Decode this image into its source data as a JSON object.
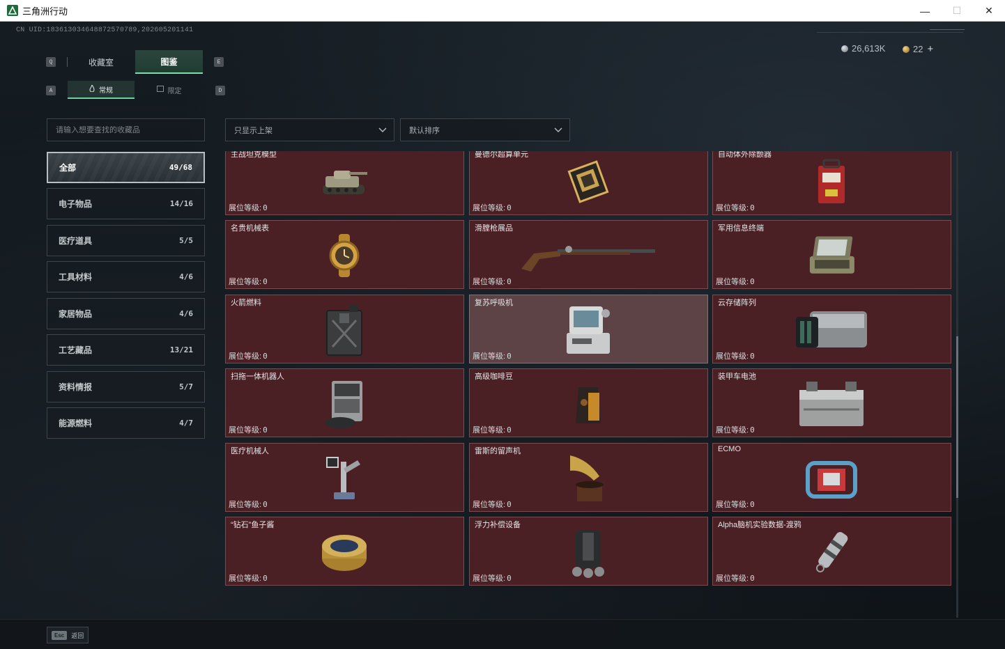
{
  "window": {
    "title": "三角洲行动",
    "minimize": "—",
    "maximize": "☐",
    "close": "✕"
  },
  "uid": "CN UID:18361303464887257078​9,202605201141",
  "currency": {
    "silver": "26,613K",
    "gold": "22",
    "plus": "+"
  },
  "keyhints": {
    "q": "Q",
    "e": "E",
    "a": "A",
    "d": "D"
  },
  "tabs": [
    {
      "label": "收藏室",
      "active": false
    },
    {
      "label": "图鉴",
      "active": true
    }
  ],
  "subtabs": [
    {
      "label": "常规",
      "icon": "flame-icon",
      "active": true
    },
    {
      "label": "限定",
      "icon": "box-icon",
      "active": false
    }
  ],
  "search": {
    "placeholder": "请输入想要查找的收藏品",
    "value": ""
  },
  "filters": {
    "display_filter": "只显示上架",
    "sort": "默认排序"
  },
  "categories": [
    {
      "label": "全部",
      "count": "49/68",
      "active": true
    },
    {
      "label": "电子物品",
      "count": "14/16",
      "active": false
    },
    {
      "label": "医疗道具",
      "count": "5/5",
      "active": false
    },
    {
      "label": "工具材料",
      "count": "4/6",
      "active": false
    },
    {
      "label": "家居物品",
      "count": "4/6",
      "active": false
    },
    {
      "label": "工艺藏品",
      "count": "13/21",
      "active": false
    },
    {
      "label": "资料情报",
      "count": "5/7",
      "active": false
    },
    {
      "label": "能源燃料",
      "count": "4/7",
      "active": false
    }
  ],
  "level_label": "展位等级:",
  "items": [
    {
      "name": "主战坦克模型",
      "level": "0",
      "icon": "tank-icon"
    },
    {
      "name": "曼德尔超算单元",
      "level": "0",
      "icon": "cpu-icon"
    },
    {
      "name": "自动体外除颤器",
      "level": "0",
      "icon": "defibrillator-icon"
    },
    {
      "name": "名贵机械表",
      "level": "0",
      "icon": "watch-icon"
    },
    {
      "name": "滑膛枪展品",
      "level": "0",
      "icon": "musket-icon"
    },
    {
      "name": "军用信息终端",
      "level": "0",
      "icon": "terminal-icon"
    },
    {
      "name": "火箭燃料",
      "level": "0",
      "icon": "fuel-can-icon"
    },
    {
      "name": "复苏呼吸机",
      "level": "0",
      "icon": "ventilator-icon",
      "highlight": true
    },
    {
      "name": "云存储阵列",
      "level": "0",
      "icon": "storage-array-icon"
    },
    {
      "name": "扫拖一体机器人",
      "level": "0",
      "icon": "robot-vacuum-icon"
    },
    {
      "name": "高级咖啡豆",
      "level": "0",
      "icon": "coffee-bag-icon"
    },
    {
      "name": "装甲车电池",
      "level": "0",
      "icon": "battery-icon"
    },
    {
      "name": "医疗机械人",
      "level": "0",
      "icon": "medical-robot-icon"
    },
    {
      "name": "雷斯的留声机",
      "level": "0",
      "icon": "gramophone-icon"
    },
    {
      "name": "ECMO",
      "level": "0",
      "icon": "ecmo-icon"
    },
    {
      "name": "“钻石”鱼子酱",
      "level": "0",
      "icon": "caviar-icon"
    },
    {
      "name": "浮力补偿设备",
      "level": "0",
      "icon": "bcd-icon"
    },
    {
      "name": "Alpha脑机实验数据-渡鸦",
      "level": "0",
      "icon": "data-vial-icon"
    }
  ],
  "bottom": {
    "esc_key": "Esc",
    "esc_label": "返回"
  },
  "colors": {
    "card_bg": "#4b2025",
    "card_highlight": "#5e4346",
    "accent_green": "#7ee0a8"
  }
}
